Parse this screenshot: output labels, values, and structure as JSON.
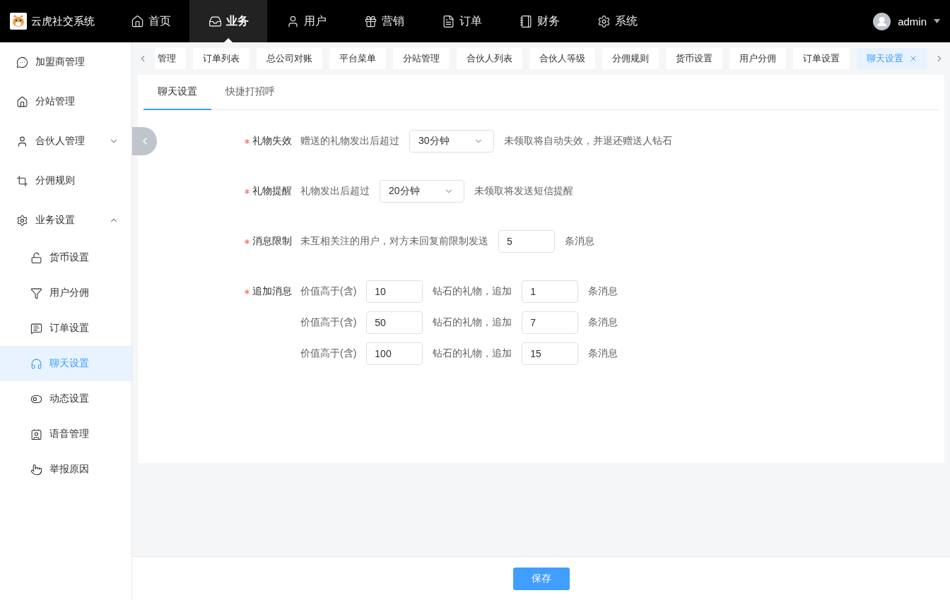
{
  "app": {
    "name": "云虎社交系统"
  },
  "nav": [
    {
      "label": "首页",
      "selected": false
    },
    {
      "label": "业务",
      "selected": true
    },
    {
      "label": "用户",
      "selected": false
    },
    {
      "label": "营销",
      "selected": false
    },
    {
      "label": "订单",
      "selected": false
    },
    {
      "label": "财务",
      "selected": false
    },
    {
      "label": "系统",
      "selected": false
    }
  ],
  "user": {
    "name": "admin"
  },
  "sidebar": [
    {
      "label": "加盟商管理",
      "kind": "item",
      "selected": false
    },
    {
      "label": "分站管理",
      "kind": "item",
      "selected": false
    },
    {
      "label": "合伙人管理",
      "kind": "submenu",
      "expanded": false,
      "selected": false
    },
    {
      "label": "分佣规则",
      "kind": "item",
      "selected": false
    },
    {
      "label": "业务设置",
      "kind": "submenu",
      "expanded": true,
      "selected": false,
      "children": [
        {
          "label": "货币设置",
          "selected": false
        },
        {
          "label": "用户分佣",
          "selected": false
        },
        {
          "label": "订单设置",
          "selected": false
        },
        {
          "label": "聊天设置",
          "selected": true
        },
        {
          "label": "动态设置",
          "selected": false
        },
        {
          "label": "语音管理",
          "selected": false
        },
        {
          "label": "举报原因",
          "selected": false
        }
      ]
    }
  ],
  "tags": [
    {
      "label": "管理",
      "selected": false
    },
    {
      "label": "订单列表",
      "selected": false
    },
    {
      "label": "总公司对账",
      "selected": false
    },
    {
      "label": "平台菜单",
      "selected": false
    },
    {
      "label": "分站管理",
      "selected": false
    },
    {
      "label": "合伙人列表",
      "selected": false
    },
    {
      "label": "合伙人等级",
      "selected": false
    },
    {
      "label": "分佣规则",
      "selected": false
    },
    {
      "label": "货币设置",
      "selected": false
    },
    {
      "label": "用户分佣",
      "selected": false
    },
    {
      "label": "订单设置",
      "selected": false
    },
    {
      "label": "聊天设置",
      "selected": true
    }
  ],
  "tabs": [
    {
      "label": "聊天设置",
      "selected": true
    },
    {
      "label": "快捷打招呼",
      "selected": false
    }
  ],
  "form": [
    {
      "kind": "select",
      "label": "礼物失效",
      "required": true,
      "prefix": "赠送的礼物发出后超过",
      "value": "30分钟",
      "suffix": "未领取将自动失效，并退还赠送人钻石"
    },
    {
      "kind": "select",
      "label": "礼物提醒",
      "required": true,
      "prefix": "礼物发出后超过",
      "value": "20分钟",
      "suffix": "未领取将发送短信提醒"
    },
    {
      "kind": "input",
      "label": "消息限制",
      "required": true,
      "prefix": "未互相关注的用户，对方未回复前限制发送",
      "value": "5",
      "suffix": "条消息"
    },
    {
      "kind": "tiers",
      "label": "追加消息",
      "required": true,
      "lines": [
        {
          "prefix": "价值高于(含)",
          "value": "10",
          "middle": "钻石的礼物，追加",
          "value2": "1",
          "suffix": "条消息"
        },
        {
          "prefix": "价值高于(含)",
          "value": "50",
          "middle": "钻石的礼物，追加",
          "value2": "7",
          "suffix": "条消息"
        },
        {
          "prefix": "价值高于(含)",
          "value": "100",
          "middle": "钻石的礼物，追加",
          "value2": "15",
          "suffix": "条消息"
        }
      ]
    }
  ],
  "save": {
    "label": "保存"
  }
}
